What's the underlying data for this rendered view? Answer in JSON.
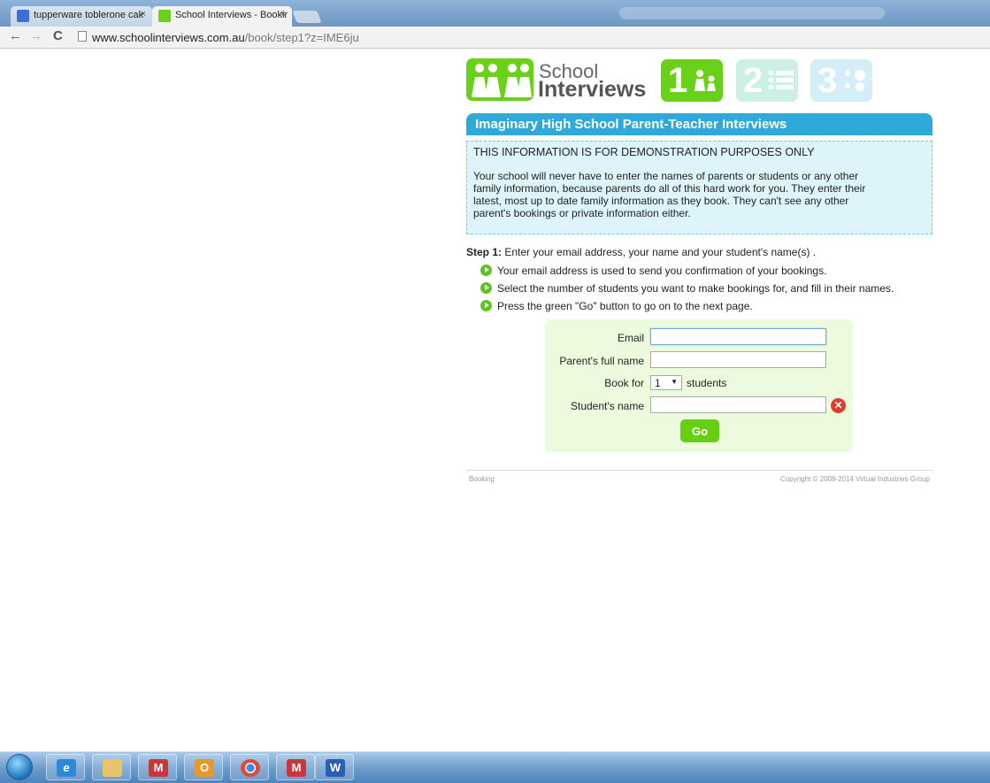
{
  "browser": {
    "tabs": [
      {
        "title": "tupperware toblerone cak",
        "close": "×",
        "favicon_color": "#3a6fd8"
      },
      {
        "title": "School Interviews - Bookir",
        "close": "×",
        "favicon_color": "#69d11a"
      }
    ],
    "nav": {
      "back": "←",
      "forward": "→",
      "reload": "C"
    },
    "url": {
      "host": "www.schoolinterviews.com.au",
      "path": "/book/step1?z=IME6ju"
    }
  },
  "logo": {
    "school": "School",
    "interviews": "Interviews"
  },
  "steps": [
    {
      "num": "1",
      "icon": "people-icon",
      "state": "active"
    },
    {
      "num": "2",
      "icon": "list-icon",
      "state": "inactive"
    },
    {
      "num": "3",
      "icon": "schedule-icon",
      "state": "inactive"
    }
  ],
  "banner": "Imaginary High School Parent-Teacher Interviews",
  "info": {
    "heading": "THIS INFORMATION IS FOR DEMONSTRATION PURPOSES ONLY",
    "body": "Your school will never have to enter the names of parents or students or any other family information, because parents do all of this hard work for you. They enter their latest, most up to date family information as they book. They can't see any other parent's bookings or private information either."
  },
  "step1": {
    "label": "Step 1:",
    "text": " Enter your email address, your name and your student's name(s) .",
    "bullets": [
      "Your email address is used to send you confirmation of your bookings.",
      "Select the number of students you want to make bookings for, and fill in their names.",
      "Press the green \"Go\" button to go on to the next page."
    ]
  },
  "form": {
    "email_label": "Email",
    "email_value": "",
    "parent_label": "Parent's full name",
    "parent_value": "",
    "bookfor_label": "Book for",
    "bookfor_value": "1",
    "students_label": "students",
    "student_label": "Student's name",
    "student_value": "",
    "remove_icon": "✕",
    "go_label": "Go"
  },
  "footer": {
    "left": "Booking",
    "right": "Copyright © 2008-2014 Virtual Industries Group"
  },
  "taskbar": [
    {
      "name": "internet-explorer",
      "glyph": "e",
      "color": "#2b8ad8"
    },
    {
      "name": "file-explorer",
      "glyph": "",
      "color": "#e8c566"
    },
    {
      "name": "gmail",
      "glyph": "M",
      "color": "#c8373a"
    },
    {
      "name": "outlook",
      "glyph": "O",
      "color": "#e69a2a"
    },
    {
      "name": "chrome",
      "glyph": "",
      "color": "#dd4b39"
    },
    {
      "name": "gmail",
      "glyph": "M",
      "color": "#c8373a"
    },
    {
      "name": "word",
      "glyph": "W",
      "color": "#2b5fb5"
    }
  ],
  "colors": {
    "brand_green": "#69d11a",
    "banner_blue": "#2ea9d9",
    "info_bg": "#dcf4fa",
    "form_bg": "#ecfbdd"
  }
}
